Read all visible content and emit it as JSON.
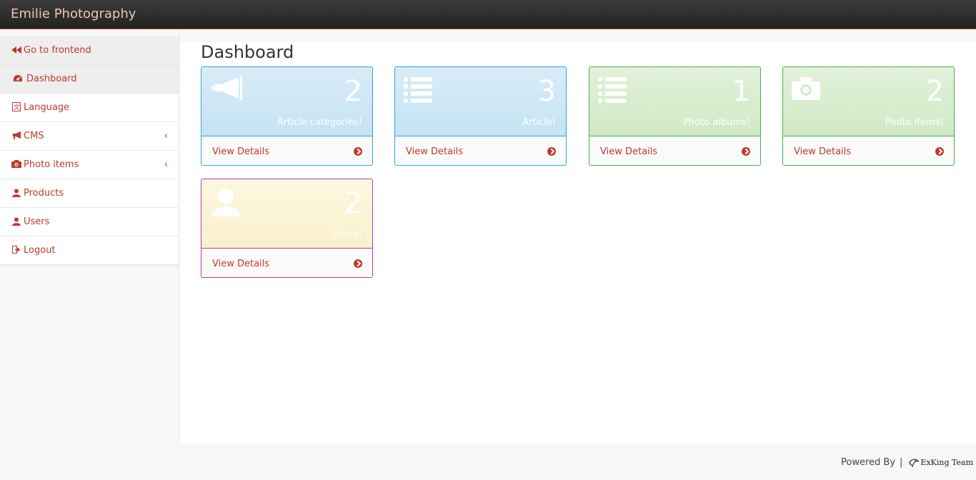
{
  "app": {
    "brand": "Emilie Photography"
  },
  "sidebar": {
    "items": [
      {
        "label": "Go to frontend",
        "icon": "backward-icon"
      },
      {
        "label": "Dashboard",
        "icon": "dashboard-icon"
      },
      {
        "label": "Language",
        "icon": "language-icon"
      },
      {
        "label": "CMS",
        "icon": "bullhorn-icon",
        "has_submenu": true
      },
      {
        "label": "Photo items",
        "icon": "camera-icon",
        "has_submenu": true
      },
      {
        "label": "Products",
        "icon": "user-icon"
      },
      {
        "label": "Users",
        "icon": "user-icon"
      },
      {
        "label": "Logout",
        "icon": "sign-out-icon"
      }
    ]
  },
  "main": {
    "title": "Dashboard",
    "cards": [
      {
        "count": "2",
        "label": "Article categories!",
        "footer": "View Details",
        "icon": "bullhorn-icon",
        "color": "#c4e3f3"
      },
      {
        "count": "3",
        "label": "Article!",
        "footer": "View Details",
        "icon": "list-icon",
        "color": "#c4e3f3"
      },
      {
        "count": "1",
        "label": "Photo albums!",
        "footer": "View Details",
        "icon": "list-icon",
        "color": "#d0e9c6"
      },
      {
        "count": "2",
        "label": "Photo items!",
        "footer": "View Details",
        "icon": "camera-icon",
        "color": "#d0e9c6"
      },
      {
        "count": "2",
        "label": "Users!",
        "footer": "View Details",
        "icon": "user-icon",
        "color": "#faf0cc"
      }
    ]
  },
  "footer": {
    "powered_by": "Powered By",
    "separator": "|",
    "team_name": "ExKing Team"
  },
  "colors": {
    "accent": "#c0392b",
    "navbar": "#222222",
    "blue_border": "#31a4dc",
    "green_border": "#4caf50",
    "purple_border": "#b23ab2"
  }
}
